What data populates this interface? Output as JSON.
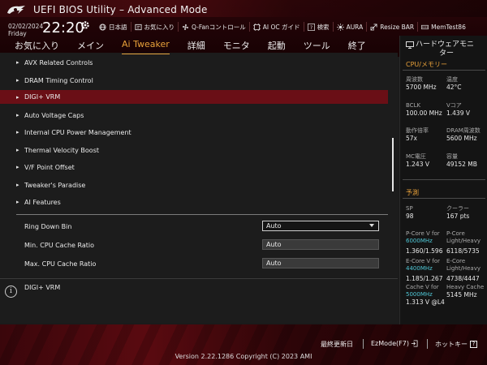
{
  "header": {
    "title": "UEFI BIOS Utility – Advanced Mode",
    "date": "02/02/2024",
    "day": "Friday",
    "time": "22:20",
    "toolbar": [
      {
        "label": "日本語",
        "icon": "globe-icon"
      },
      {
        "label": "お気に入り",
        "icon": "favorite-icon"
      },
      {
        "label": "Q-Fanコントロール",
        "icon": "fan-icon"
      },
      {
        "label": "AI OC ガイド",
        "icon": "ai-icon"
      },
      {
        "label": "検索",
        "icon": "search-icon"
      },
      {
        "label": "AURA",
        "icon": "aura-icon"
      },
      {
        "label": "Resize BAR",
        "icon": "resize-bar-icon"
      },
      {
        "label": "MemTest86",
        "icon": "memtest-icon"
      }
    ]
  },
  "nav": {
    "tabs": [
      "お気に入り",
      "メイン",
      "Ai Tweaker",
      "詳細",
      "モニタ",
      "起動",
      "ツール",
      "終了"
    ],
    "active": "Ai Tweaker"
  },
  "menu": {
    "items": [
      "AVX Related Controls",
      "DRAM Timing Control",
      "DIGI+ VRM",
      "Auto Voltage Caps",
      "Internal CPU Power Management",
      "Thermal Velocity Boost",
      "V/F Point Offset",
      "Tweaker's Paradise",
      "AI Features"
    ],
    "selected": "DIGI+ VRM"
  },
  "settings": [
    {
      "label": "Ring Down Bin",
      "value": "Auto",
      "kind": "select"
    },
    {
      "label": "Min. CPU Cache Ratio",
      "value": "Auto",
      "kind": "input"
    },
    {
      "label": "Max. CPU Cache Ratio",
      "value": "Auto",
      "kind": "input"
    }
  ],
  "help": {
    "text": "DIGI+ VRM"
  },
  "hw_monitor": {
    "title_line1": "ハードウェアモニ",
    "title_line2": "ター",
    "cpu_section": "CPU/メモリー",
    "cpu": [
      {
        "label": "周波数",
        "value": "5700 MHz"
      },
      {
        "label": "温度",
        "value": "42°C"
      },
      {
        "label": "BCLK",
        "value": "100.00 MHz"
      },
      {
        "label": "Vコア",
        "value": "1.439 V"
      },
      {
        "label": "動作倍率",
        "value": "57x"
      },
      {
        "label": "DRAM周波数",
        "value": "5600 MHz"
      },
      {
        "label": "MC電圧",
        "value": "1.243 V"
      },
      {
        "label": "容量",
        "value": "49152 MB"
      }
    ],
    "predict_section": "予測",
    "predict_sp_label": "SP",
    "predict_sp_value": "98",
    "predict_cooler_label": "クーラー",
    "predict_cooler_value": "167 pts",
    "pcore_label": "P-Core V for",
    "pcore_freq": "6000MHz",
    "pcore_value": "1.360/1.596",
    "pcore_lh_label": "P-Core",
    "pcore_lh_label2": "Light/Heavy",
    "pcore_lh_value": "6118/5735",
    "ecore_label": "E-Core V for",
    "ecore_freq": "4400MHz",
    "ecore_value": "1.185/1.267",
    "ecore_lh_label": "E-Core",
    "ecore_lh_label2": "Light/Heavy",
    "ecore_lh_value": "4738/4447",
    "cache_label": "Cache V for",
    "cache_freq": "5000MHz",
    "cache_value": "1.313 V @L4",
    "heavy_cache_label": "Heavy Cache",
    "heavy_cache_value": "5145 MHz"
  },
  "footer": {
    "last_modified": "最終更新日",
    "ezmode": "EzMode(F7)",
    "hotkeys": "ホットキー",
    "hotkeys_symbol": "?",
    "copyright": "Version 2.22.1286 Copyright (C) 2023 AMI"
  },
  "colors": {
    "accent": "#e8a13a",
    "selected_row": "#6a0f16",
    "freq_highlight": "#4fc7d6"
  }
}
